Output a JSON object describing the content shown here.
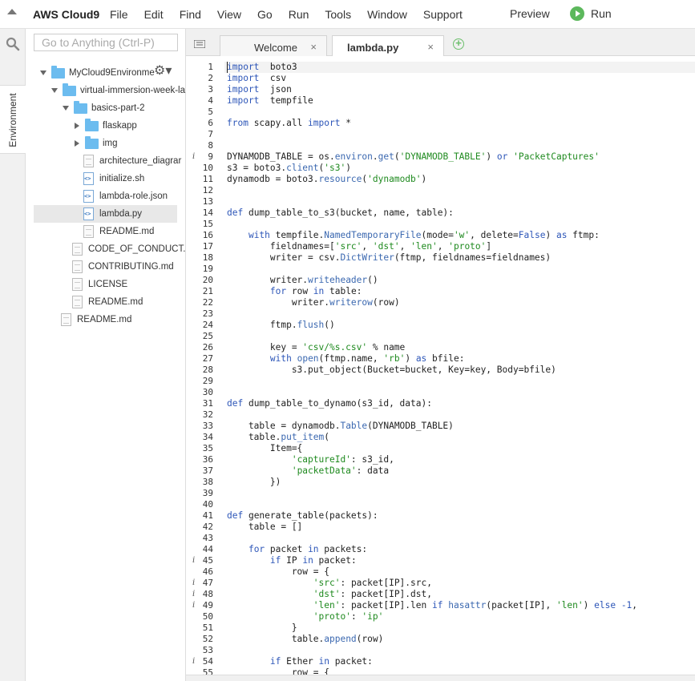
{
  "menubar": {
    "brand": "AWS Cloud9",
    "items": [
      "File",
      "Edit",
      "Find",
      "View",
      "Go",
      "Run",
      "Tools",
      "Window",
      "Support"
    ],
    "preview": "Preview",
    "run": "Run"
  },
  "sidebar": {
    "environment_tab": "Environment",
    "goto_placeholder": "Go to Anything (Ctrl-P)"
  },
  "tree": [
    {
      "label": "MyCloud9Environme",
      "type": "folder",
      "depth": 0,
      "expanded": true
    },
    {
      "label": "virtual-immersion-week-la",
      "type": "folder",
      "depth": 1,
      "expanded": true
    },
    {
      "label": "basics-part-2",
      "type": "folder",
      "depth": 2,
      "expanded": true
    },
    {
      "label": "flaskapp",
      "type": "folder",
      "depth": 3,
      "expanded": false
    },
    {
      "label": "img",
      "type": "folder",
      "depth": 3,
      "expanded": false
    },
    {
      "label": "architecture_diagrar",
      "type": "file",
      "depth": 3
    },
    {
      "label": "initialize.sh",
      "type": "code",
      "depth": 3
    },
    {
      "label": "lambda-role.json",
      "type": "code",
      "depth": 3
    },
    {
      "label": "lambda.py",
      "type": "code",
      "depth": 3,
      "selected": true
    },
    {
      "label": "README.md",
      "type": "file",
      "depth": 3
    },
    {
      "label": "CODE_OF_CONDUCT.r",
      "type": "file",
      "depth": 2
    },
    {
      "label": "CONTRIBUTING.md",
      "type": "file",
      "depth": 2
    },
    {
      "label": "LICENSE",
      "type": "file",
      "depth": 2
    },
    {
      "label": "README.md",
      "type": "file",
      "depth": 2
    },
    {
      "label": "README.md",
      "type": "file",
      "depth": 1
    }
  ],
  "tabs": {
    "welcome": "Welcome",
    "active": "lambda.py",
    "close": "×",
    "add": "+"
  },
  "editor": {
    "info_lines": [
      9,
      45,
      47,
      48,
      49,
      54
    ],
    "lines": [
      [
        [
          "kw",
          "import"
        ],
        [
          "",
          "  boto3"
        ]
      ],
      [
        [
          "kw",
          "import"
        ],
        [
          "",
          "  csv"
        ]
      ],
      [
        [
          "kw",
          "import"
        ],
        [
          "",
          "  json"
        ]
      ],
      [
        [
          "kw",
          "import"
        ],
        [
          "",
          "  tempfile"
        ]
      ],
      [],
      [
        [
          "kw",
          "from"
        ],
        [
          "",
          " scapy.all "
        ],
        [
          "kw",
          "import"
        ],
        [
          "",
          " *"
        ]
      ],
      [],
      [],
      [
        [
          "",
          "DYNAMODB_TABLE = os."
        ],
        [
          "fn",
          "environ"
        ],
        [
          "",
          "."
        ],
        [
          "fn",
          "get"
        ],
        [
          "",
          "("
        ],
        [
          "str",
          "'DYNAMODB_TABLE'"
        ],
        [
          "",
          ") "
        ],
        [
          "kw",
          "or"
        ],
        [
          "",
          " "
        ],
        [
          "str",
          "'PacketCaptures'"
        ]
      ],
      [
        [
          "",
          "s3 = boto3."
        ],
        [
          "fn",
          "client"
        ],
        [
          "",
          "("
        ],
        [
          "str",
          "'s3'"
        ],
        [
          "",
          ")"
        ]
      ],
      [
        [
          "",
          "dynamodb = boto3."
        ],
        [
          "fn",
          "resource"
        ],
        [
          "",
          "("
        ],
        [
          "str",
          "'dynamodb'"
        ],
        [
          "",
          ")"
        ]
      ],
      [],
      [],
      [
        [
          "kw",
          "def"
        ],
        [
          "",
          " dump_table_to_s3(bucket, name, table):"
        ]
      ],
      [],
      [
        [
          "",
          "    "
        ],
        [
          "kw",
          "with"
        ],
        [
          "",
          " tempfile."
        ],
        [
          "fn",
          "NamedTemporaryFile"
        ],
        [
          "",
          "(mode="
        ],
        [
          "str",
          "'w'"
        ],
        [
          "",
          ", delete="
        ],
        [
          "kw",
          "False"
        ],
        [
          "",
          ") "
        ],
        [
          "kw",
          "as"
        ],
        [
          "",
          " ftmp:"
        ]
      ],
      [
        [
          "",
          "        fieldnames=["
        ],
        [
          "str",
          "'src'"
        ],
        [
          "",
          ", "
        ],
        [
          "str",
          "'dst'"
        ],
        [
          "",
          ", "
        ],
        [
          "str",
          "'len'"
        ],
        [
          "",
          ", "
        ],
        [
          "str",
          "'proto'"
        ],
        [
          "",
          "]"
        ]
      ],
      [
        [
          "",
          "        writer = csv."
        ],
        [
          "fn",
          "DictWriter"
        ],
        [
          "",
          "(ftmp, fieldnames=fieldnames)"
        ]
      ],
      [],
      [
        [
          "",
          "        writer."
        ],
        [
          "fn",
          "writeheader"
        ],
        [
          "",
          "()"
        ]
      ],
      [
        [
          "",
          "        "
        ],
        [
          "kw",
          "for"
        ],
        [
          "",
          " row "
        ],
        [
          "kw",
          "in"
        ],
        [
          "",
          " table:"
        ]
      ],
      [
        [
          "",
          "            writer."
        ],
        [
          "fn",
          "writerow"
        ],
        [
          "",
          "(row)"
        ]
      ],
      [],
      [
        [
          "",
          "        ftmp."
        ],
        [
          "fn",
          "flush"
        ],
        [
          "",
          "()"
        ]
      ],
      [],
      [
        [
          "",
          "        key = "
        ],
        [
          "str",
          "'csv/%s.csv'"
        ],
        [
          "",
          " % name"
        ]
      ],
      [
        [
          "",
          "        "
        ],
        [
          "kw",
          "with"
        ],
        [
          "",
          " "
        ],
        [
          "fn",
          "open"
        ],
        [
          "",
          "(ftmp.name, "
        ],
        [
          "str",
          "'rb'"
        ],
        [
          "",
          ") "
        ],
        [
          "kw",
          "as"
        ],
        [
          "",
          " bfile:"
        ]
      ],
      [
        [
          "",
          "            s3.put_object(Bucket=bucket, Key=key, Body=bfile)"
        ]
      ],
      [],
      [],
      [
        [
          "kw",
          "def"
        ],
        [
          "",
          " dump_table_to_dynamo(s3_id, data):"
        ]
      ],
      [],
      [
        [
          "",
          "    table = dynamodb."
        ],
        [
          "fn",
          "Table"
        ],
        [
          "",
          "(DYNAMODB_TABLE)"
        ]
      ],
      [
        [
          "",
          "    table."
        ],
        [
          "fn",
          "put_item"
        ],
        [
          "",
          "("
        ]
      ],
      [
        [
          "",
          "        Item={"
        ]
      ],
      [
        [
          "",
          "            "
        ],
        [
          "str",
          "'captureId'"
        ],
        [
          "",
          ": s3_id,"
        ]
      ],
      [
        [
          "",
          "            "
        ],
        [
          "str",
          "'packetData'"
        ],
        [
          "",
          ": data"
        ]
      ],
      [
        [
          "",
          "        })"
        ]
      ],
      [],
      [],
      [
        [
          "kw",
          "def"
        ],
        [
          "",
          " generate_table(packets):"
        ]
      ],
      [
        [
          "",
          "    table = []"
        ]
      ],
      [],
      [
        [
          "",
          "    "
        ],
        [
          "kw",
          "for"
        ],
        [
          "",
          " packet "
        ],
        [
          "kw",
          "in"
        ],
        [
          "",
          " packets:"
        ]
      ],
      [
        [
          "",
          "        "
        ],
        [
          "kw",
          "if"
        ],
        [
          "",
          " IP "
        ],
        [
          "kw",
          "in"
        ],
        [
          "",
          " packet:"
        ]
      ],
      [
        [
          "",
          "            row = {"
        ]
      ],
      [
        [
          "",
          "                "
        ],
        [
          "str",
          "'src'"
        ],
        [
          "",
          ": packet[IP].src,"
        ]
      ],
      [
        [
          "",
          "                "
        ],
        [
          "str",
          "'dst'"
        ],
        [
          "",
          ": packet[IP].dst,"
        ]
      ],
      [
        [
          "",
          "                "
        ],
        [
          "str",
          "'len'"
        ],
        [
          "",
          ": packet[IP].len "
        ],
        [
          "kw",
          "if"
        ],
        [
          "",
          " "
        ],
        [
          "fn",
          "hasattr"
        ],
        [
          "",
          "(packet[IP], "
        ],
        [
          "str",
          "'len'"
        ],
        [
          "",
          ") "
        ],
        [
          "kw",
          "else"
        ],
        [
          "",
          " "
        ],
        [
          "num",
          "-1"
        ],
        [
          "",
          ","
        ]
      ],
      [
        [
          "",
          "                "
        ],
        [
          "str",
          "'proto'"
        ],
        [
          "",
          ": "
        ],
        [
          "str",
          "'ip'"
        ]
      ],
      [
        [
          "",
          "            }"
        ]
      ],
      [
        [
          "",
          "            table."
        ],
        [
          "fn",
          "append"
        ],
        [
          "",
          "(row)"
        ]
      ],
      [],
      [
        [
          "",
          "        "
        ],
        [
          "kw",
          "if"
        ],
        [
          "",
          " Ether "
        ],
        [
          "kw",
          "in"
        ],
        [
          "",
          " packet:"
        ]
      ],
      [
        [
          "",
          "            row = {"
        ]
      ]
    ]
  }
}
